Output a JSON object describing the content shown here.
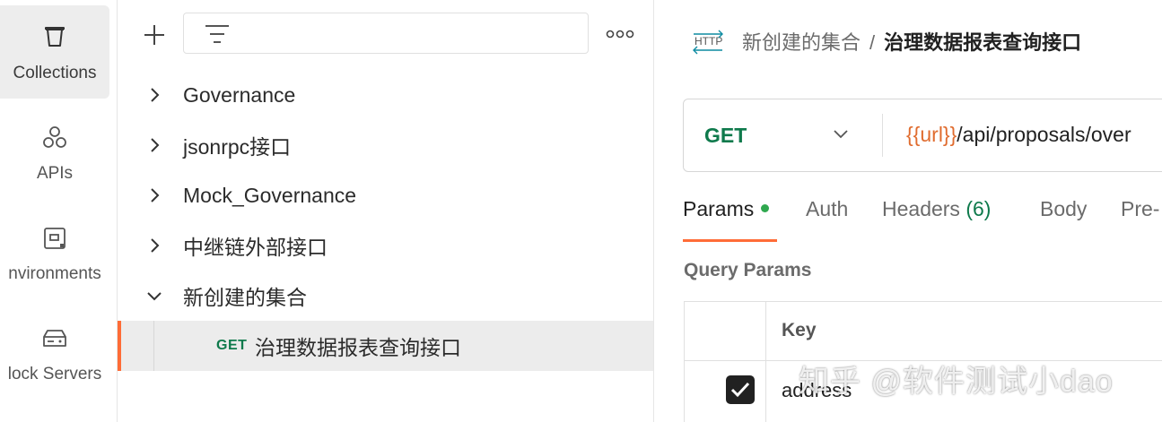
{
  "rail": {
    "items": [
      {
        "label": "Collections",
        "icon": "trash-bin-like-collection-icon",
        "active": true
      },
      {
        "label": "APIs",
        "icon": "apis-icon"
      },
      {
        "label": "nvironments",
        "icon": "environments-icon"
      },
      {
        "label": "lock Servers",
        "icon": "mock-server-icon"
      }
    ]
  },
  "tree": {
    "add_icon": "plus-icon",
    "filter_icon": "filter-icon",
    "more_icon": "more-icon",
    "collections": [
      {
        "name": "Governance",
        "expanded": false
      },
      {
        "name": "jsonrpc接口",
        "expanded": false
      },
      {
        "name": "Mock_Governance",
        "expanded": false
      },
      {
        "name": "中继链外部接口",
        "expanded": false
      },
      {
        "name": "新创建的集合",
        "expanded": true
      }
    ],
    "selected_request": {
      "method": "GET",
      "name": "治理数据报表查询接口"
    }
  },
  "main": {
    "breadcrumb": {
      "icon": "http-icon",
      "parent": "新创建的集合",
      "separator": "/",
      "current": "治理数据报表查询接口"
    },
    "request": {
      "method": "GET",
      "url_var": "{{url}}",
      "url_path": "/api/proposals/over"
    },
    "tabs": {
      "params": "Params",
      "auth": "Auth",
      "headers": "Headers",
      "headers_count": "(6)",
      "body": "Body",
      "pre": "Pre-"
    },
    "query_params": {
      "title": "Query Params",
      "key_header": "Key",
      "rows": [
        {
          "checked": true,
          "key": "address"
        }
      ]
    }
  },
  "watermark": "知乎 @软件测试小dao",
  "colors": {
    "accent": "#ff6c37",
    "get_method": "#0f7a4c",
    "url_variable": "#e06c2f",
    "params_dot": "#2fa84f"
  }
}
